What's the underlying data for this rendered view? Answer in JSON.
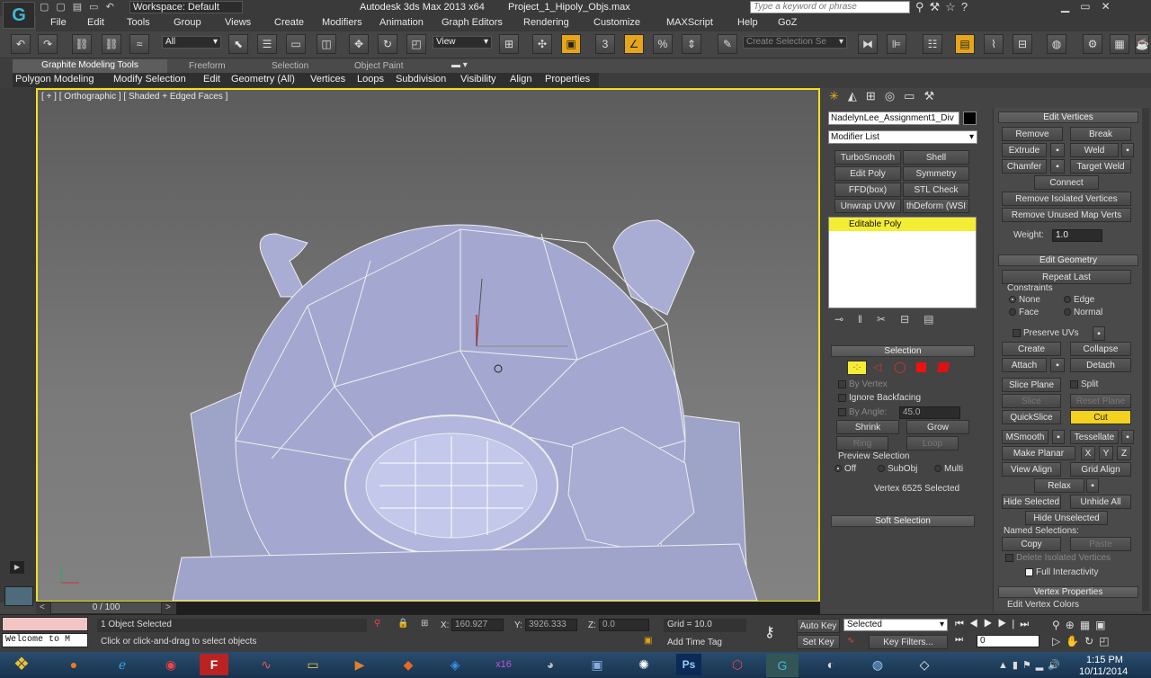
{
  "title_bar": {
    "workspace": "Workspace: Default",
    "title": "Autodesk 3ds Max  2013 x64",
    "file": "Project_1_Hipoly_Objs.max",
    "search_placeholder": "Type a keyword or phrase"
  },
  "menu": [
    "File",
    "Edit",
    "Tools",
    "Group",
    "Views",
    "Create",
    "Modifiers",
    "Animation",
    "Graph Editors",
    "Rendering",
    "Customize",
    "MAXScript",
    "Help",
    "GoZ"
  ],
  "main_toolbar": {
    "selection_filter": "All",
    "ref_coord": "View",
    "named_selection_placeholder": "Create Selection Se",
    "snap_label": "3"
  },
  "ribbon_tabs": [
    "Graphite Modeling Tools",
    "Freeform",
    "Selection",
    "Object Paint"
  ],
  "ribbon_panels": [
    "Polygon Modeling",
    "Modify Selection",
    "Edit",
    "Geometry (All)",
    "Vertices",
    "Loops",
    "Subdivision",
    "Visibility",
    "Align",
    "Properties"
  ],
  "viewport": {
    "label": "[ + ] [ Orthographic ] [ Shaded + Edged Faces ]"
  },
  "command_panel": {
    "object_name": "NadelynLee_Assignment1_Div",
    "modifier_list": "Modifier List",
    "modifier_buttons": [
      "TurboSmooth",
      "Shell",
      "Edit Poly",
      "Symmetry",
      "FFD(box)",
      "STL Check",
      "Unwrap UVW",
      "thDeform (WSI"
    ],
    "stack_item": "Editable Poly"
  },
  "selection_rollout": {
    "title": "Selection",
    "by_vertex": "By Vertex",
    "ignore_backfacing": "Ignore Backfacing",
    "by_angle": "By Angle:",
    "angle": "45.0",
    "shrink": "Shrink",
    "grow": "Grow",
    "ring": "Ring",
    "loop": "Loop",
    "preview": "Preview Selection",
    "preview_options": [
      "Off",
      "SubObj",
      "Multi"
    ],
    "status": "Vertex 6525 Selected",
    "soft_selection": "Soft Selection"
  },
  "edit_vertices": {
    "title": "Edit Vertices",
    "remove": "Remove",
    "break": "Break",
    "extrude": "Extrude",
    "weld": "Weld",
    "chamfer": "Chamfer",
    "target_weld": "Target Weld",
    "connect": "Connect",
    "remove_isolated": "Remove Isolated Vertices",
    "remove_unused": "Remove Unused Map Verts",
    "weight_label": "Weight:",
    "weight": "1.0"
  },
  "edit_geometry": {
    "title": "Edit Geometry",
    "repeat_last": "Repeat Last",
    "constraints": "Constraints",
    "constraint_options": [
      "None",
      "Edge",
      "Face",
      "Normal"
    ],
    "preserve_uvs": "Preserve UVs",
    "create": "Create",
    "collapse": "Collapse",
    "attach": "Attach",
    "detach": "Detach",
    "slice_plane": "Slice Plane",
    "split": "Split",
    "slice": "Slice",
    "reset_plane": "Reset Plane",
    "quickslice": "QuickSlice",
    "cut": "Cut",
    "msmooth": "MSmooth",
    "tessellate": "Tessellate",
    "make_planar": "Make Planar",
    "x": "X",
    "y": "Y",
    "z": "Z",
    "view_align": "View Align",
    "grid_align": "Grid Align",
    "relax": "Relax",
    "hide_selected": "Hide Selected",
    "unhide_all": "Unhide All",
    "hide_unselected": "Hide Unselected",
    "named_selections": "Named Selections:",
    "copy": "Copy",
    "paste": "Paste",
    "delete_isolated": "Delete Isolated Vertices",
    "full_interactivity": "Full Interactivity"
  },
  "vertex_properties": {
    "title": "Vertex Properties",
    "edit_colors": "Edit Vertex Colors"
  },
  "timeline": {
    "frame": "0 / 100"
  },
  "status": {
    "listener": "Welcome to M",
    "selected": "1 Object Selected",
    "prompt": "Click or click-and-drag to select objects",
    "x_label": "X:",
    "x": "160.927",
    "y_label": "Y:",
    "y": "3926.333",
    "z_label": "Z:",
    "z": "0.0",
    "grid": "Grid = 10.0",
    "add_time_tag": "Add Time Tag",
    "auto_key": "Auto Key",
    "set_key": "Set Key",
    "key_mode": "Selected",
    "key_filters": "Key Filters...",
    "frame_field": "0"
  },
  "taskbar": {
    "time": "1:15 PM",
    "date": "10/11/2014"
  }
}
